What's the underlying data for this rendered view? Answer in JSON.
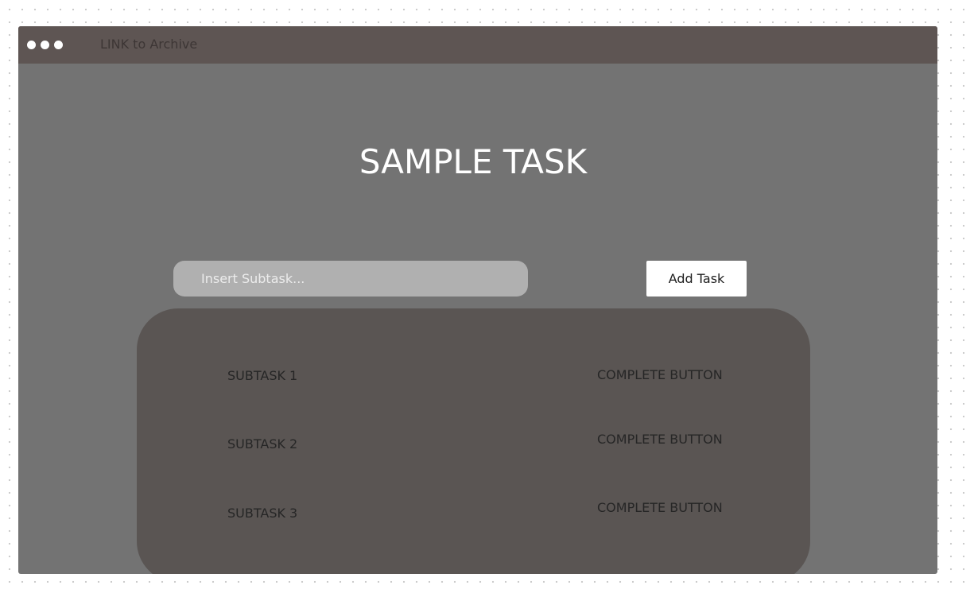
{
  "window": {
    "archive_link": "LINK to Archive"
  },
  "main": {
    "title": "SAMPLE TASK",
    "subtask_input": {
      "placeholder": "Insert Subtask...",
      "value": ""
    },
    "add_button_label": "Add Task"
  },
  "subtasks": [
    {
      "label": "SUBTASK 1",
      "action_label": "COMPLETE BUTTON"
    },
    {
      "label": "SUBTASK 2",
      "action_label": "COMPLETE BUTTON"
    },
    {
      "label": "SUBTASK 3",
      "action_label": "COMPLETE BUTTON"
    }
  ],
  "colors": {
    "titlebar": "#5e5553",
    "window_background": "#737373",
    "subtask_panel": "#5a5553",
    "input_background": "#b0b0b0",
    "button_background": "#ffffff"
  }
}
